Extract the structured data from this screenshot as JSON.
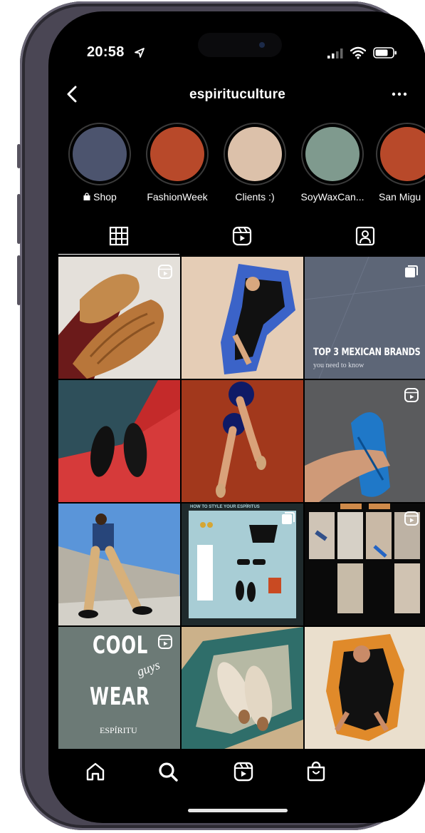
{
  "status_bar": {
    "time": "20:58"
  },
  "header": {
    "username": "espirituculture"
  },
  "highlights": [
    {
      "label": "Shop",
      "color": "#4c546e",
      "shop_icon": true
    },
    {
      "label": "FashionWeek",
      "color": "#b8492a"
    },
    {
      "label": "Clients :)",
      "color": "#dcc1aa"
    },
    {
      "label": "SoyWaxCan...",
      "color": "#7f9a8e"
    },
    {
      "label": "San Migu",
      "color": "#b8492a"
    }
  ],
  "tabs": [
    {
      "name": "grid-icon",
      "active": true
    },
    {
      "name": "reels-icon",
      "active": false
    },
    {
      "name": "tagged-icon",
      "active": false
    }
  ],
  "posts": [
    {
      "type": "reel",
      "desc": "gold woven huarache loafers"
    },
    {
      "type": "photo",
      "desc": "woman sitting, blue cutout collage"
    },
    {
      "type": "carousel",
      "overlay_title": "TOP 3 MEXICAN BRANDS",
      "overlay_sub": "you need to know"
    },
    {
      "type": "photo",
      "desc": "black huaraches on red car"
    },
    {
      "type": "photo",
      "desc": "legs on red background"
    },
    {
      "type": "reel",
      "desc": "hand holding blue sandal"
    },
    {
      "type": "photo",
      "desc": "man with building backdrop"
    },
    {
      "type": "carousel",
      "banner_text": "HOW TO STYLE YOUR ESPÍRITUS"
    },
    {
      "type": "reel",
      "desc": "collage grid of outfits"
    },
    {
      "type": "reel",
      "overlay_l1": "COOL",
      "overlay_l2": "guys",
      "overlay_l3": "WEAR",
      "overlay_logo": "ESPÍRITU"
    },
    {
      "type": "photo",
      "desc": "espadrilles on rug"
    },
    {
      "type": "photo",
      "desc": "woman sitting, orange cutout collage"
    }
  ],
  "bottom_nav": [
    "home-icon",
    "search-icon",
    "reels-icon",
    "shop-icon"
  ]
}
